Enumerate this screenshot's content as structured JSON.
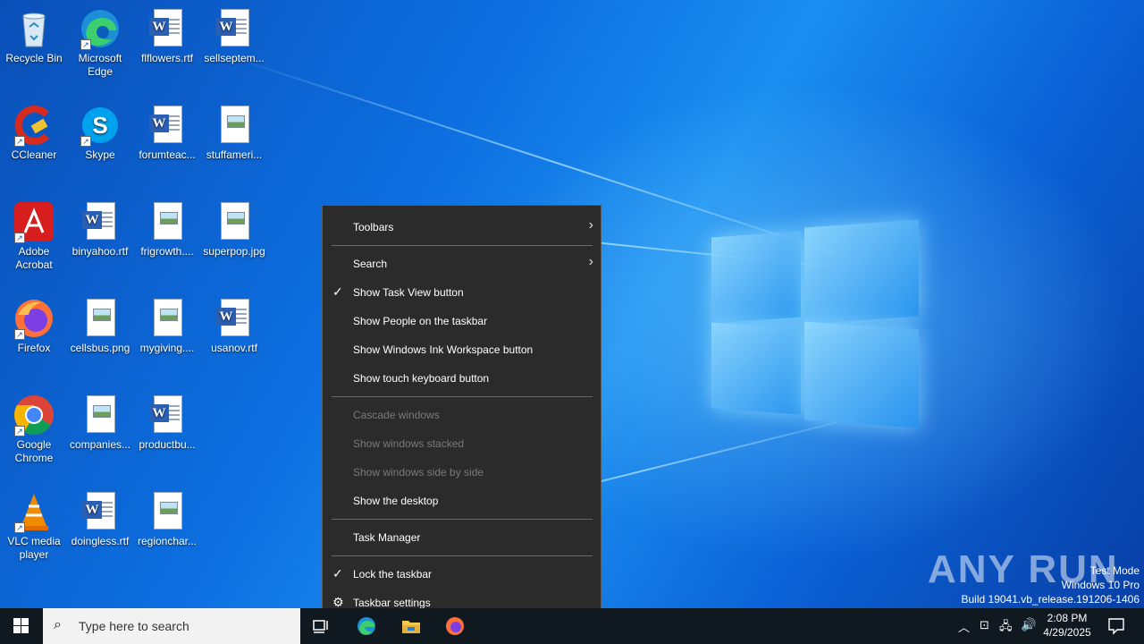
{
  "desktop_icons": [
    {
      "label": "Recycle Bin",
      "icon": "recycle-bin-icon"
    },
    {
      "label": "Microsoft Edge",
      "icon": "edge-icon"
    },
    {
      "label": "flflowers.rtf",
      "icon": "word-doc-icon"
    },
    {
      "label": "sellseptem...",
      "icon": "word-doc-icon"
    },
    {
      "label": "CCleaner",
      "icon": "ccleaner-icon"
    },
    {
      "label": "Skype",
      "icon": "skype-icon"
    },
    {
      "label": "forumteac...",
      "icon": "word-doc-icon"
    },
    {
      "label": "stuffameri...",
      "icon": "image-file-icon"
    },
    {
      "label": "Adobe Acrobat",
      "icon": "acrobat-icon"
    },
    {
      "label": "binyahoo.rtf",
      "icon": "word-doc-icon"
    },
    {
      "label": "frigrowth....",
      "icon": "image-file-icon"
    },
    {
      "label": "superpop.jpg",
      "icon": "image-file-icon"
    },
    {
      "label": "Firefox",
      "icon": "firefox-icon"
    },
    {
      "label": "cellsbus.png",
      "icon": "image-file-icon"
    },
    {
      "label": "mygiving....",
      "icon": "image-file-icon"
    },
    {
      "label": "usanov.rtf",
      "icon": "word-doc-icon"
    },
    {
      "label": "Google Chrome",
      "icon": "chrome-icon"
    },
    {
      "label": "companies...",
      "icon": "image-file-icon"
    },
    {
      "label": "productbu...",
      "icon": "word-doc-icon"
    },
    {
      "label": "VLC media player",
      "icon": "vlc-icon"
    },
    {
      "label": "doingless.rtf",
      "icon": "word-doc-icon"
    },
    {
      "label": "regionchar...",
      "icon": "image-file-icon"
    }
  ],
  "context_menu": {
    "toolbars": "Toolbars",
    "search": "Search",
    "show_task_view": "Show Task View button",
    "show_people": "Show People on the taskbar",
    "show_ink": "Show Windows Ink Workspace button",
    "show_touch_keyboard": "Show touch keyboard button",
    "cascade": "Cascade windows",
    "stacked": "Show windows stacked",
    "side_by_side": "Show windows side by side",
    "show_desktop": "Show the desktop",
    "task_manager": "Task Manager",
    "lock_taskbar": "Lock the taskbar",
    "taskbar_settings": "Taskbar settings"
  },
  "taskbar": {
    "search_placeholder": "Type here to search",
    "time": "2:08 PM",
    "date": "4/29/2025"
  },
  "watermark": {
    "line1": "Test Mode",
    "line2": "Windows 10 Pro",
    "line3": "Build 19041.vb_release.191206-1406",
    "brand": "ANY RUN"
  },
  "colors": {
    "menu_bg": "#2b2b2b",
    "taskbar_bg": "#101820",
    "desktop_accent": "#0d6fe0"
  }
}
